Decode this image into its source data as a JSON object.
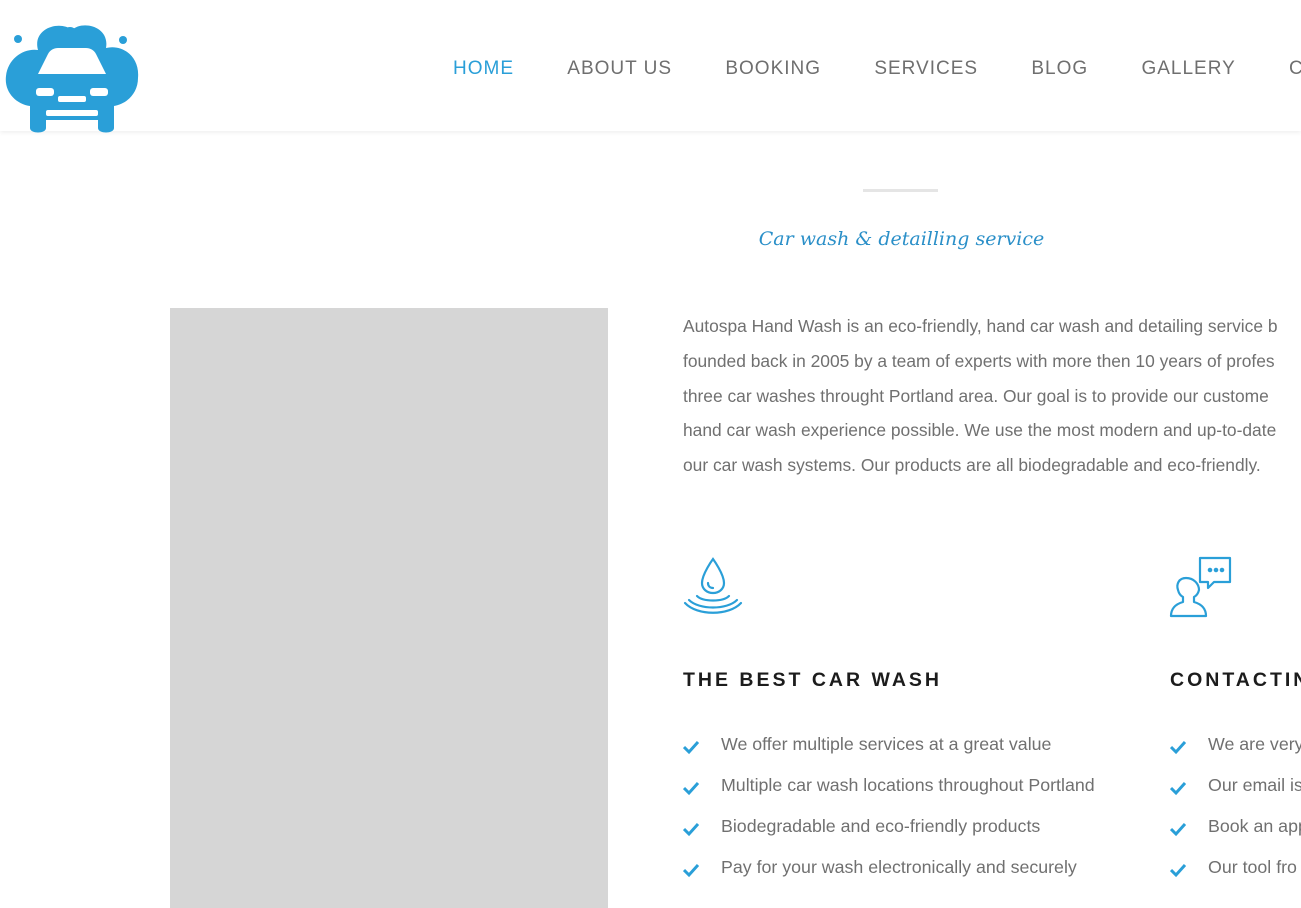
{
  "brand": {
    "accent": "#2a9fd8",
    "text": "#707070",
    "heading": "#1c1c1c"
  },
  "nav": [
    {
      "label": "HOME",
      "active": true
    },
    {
      "label": "ABOUT US"
    },
    {
      "label": "BOOKING"
    },
    {
      "label": "SERVICES"
    },
    {
      "label": "BLOG"
    },
    {
      "label": "GALLERY"
    },
    {
      "label": "CON"
    }
  ],
  "about": {
    "tagline": "Car wash & detailling service",
    "intro_lines": [
      "Autospa Hand Wash is an eco-friendly, hand car wash and detailing service b",
      "founded back in 2005 by a team of experts with more then 10 years of profes",
      "three car washes throught Portland area. Our goal is to provide our custome",
      "hand car wash experience possible. We use the most modern and up-to-date",
      "our car wash systems. Our products are all biodegradable and eco-friendly."
    ]
  },
  "features": [
    {
      "icon": "water-drop-icon",
      "title": "THE BEST CAR WASH",
      "items": [
        "We offer multiple services at a great value",
        "Multiple car wash locations throughout Portland",
        "Biodegradable and eco-friendly products",
        "Pay for your wash electronically and securely"
      ]
    },
    {
      "icon": "person-chat-icon",
      "title": "CONTACTIN",
      "items": [
        "We are very",
        "Our email is",
        "Book an app",
        "Our tool fro"
      ]
    }
  ]
}
